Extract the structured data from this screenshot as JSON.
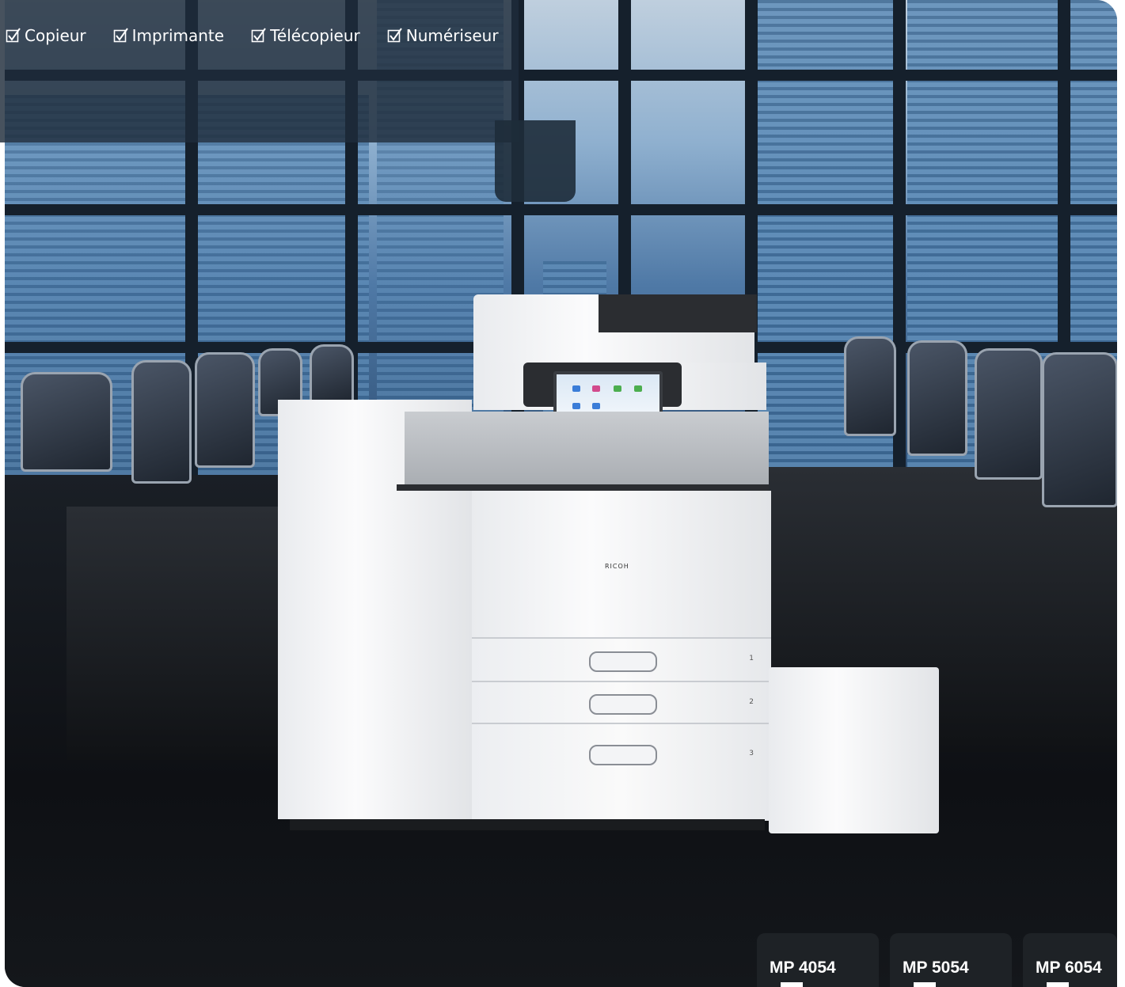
{
  "features": [
    {
      "label": "Copieur"
    },
    {
      "label": "Imprimante"
    },
    {
      "label": "Télécopieur"
    },
    {
      "label": "Numériseur"
    }
  ],
  "models": [
    {
      "label": "MP 4054"
    },
    {
      "label": "MP 5054"
    },
    {
      "label": "MP 6054"
    }
  ],
  "product": {
    "brand": "RICOH",
    "trays": [
      "1",
      "2",
      "3"
    ]
  },
  "colors": {
    "overlay": "#1e2c3a",
    "tab": "#1e2226",
    "text": "#ffffff"
  }
}
